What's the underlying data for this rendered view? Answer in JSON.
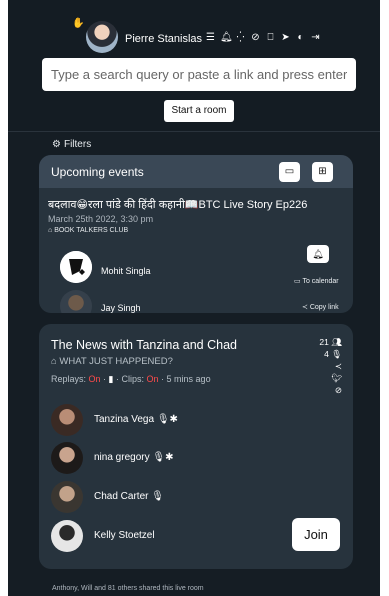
{
  "header": {
    "username": "Pierre Stanislas",
    "hand_icon": "✋",
    "icons": [
      "menu-icon",
      "bell-icon",
      "loader-icon",
      "compass-icon",
      "bookmark-icon",
      "send-icon",
      "contrast-icon",
      "logout-icon"
    ]
  },
  "search": {
    "placeholder": "Type a search query or paste a link and press enter"
  },
  "start_room": "Start a room",
  "filters": "Filters",
  "upcoming": {
    "title": "Upcoming events",
    "event": {
      "title": "बदलाव😁रला पांडे की हिंदी कहानी📖BTC Live Story Ep226",
      "date": "March 25th 2022, 3:30 pm",
      "club": "BOOK TALKERS CLUB",
      "hosts": [
        "Mohit Singla",
        "Jay Singh"
      ],
      "to_calendar": "To calendar",
      "copy_link": "Copy link"
    }
  },
  "room": {
    "title": "The News with Tanzina and Chad",
    "subtitle": "WHAT JUST HAPPENED?",
    "replays_label": "Replays:",
    "replays_value": "On",
    "clips_label": "Clips:",
    "clips_value": "On",
    "time": "5 mins ago",
    "listeners": "21",
    "speakers_count": "4",
    "speakers": [
      "Tanzina Vega",
      "nina gregory",
      "Chad Carter",
      "Kelly Stoetzel"
    ],
    "join": "Join"
  },
  "shared_text": "Anthony, Will and 81 others shared this live room",
  "colors": {
    "background": "#151d24",
    "card": "#27333d",
    "card_header": "#3a4856",
    "accent_red": "#ff4b4b"
  }
}
